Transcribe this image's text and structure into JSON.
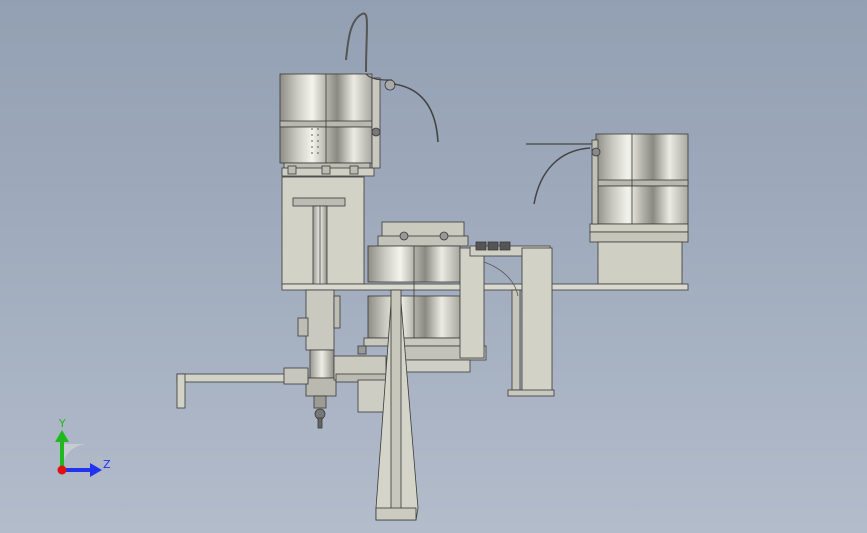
{
  "viewport": {
    "background_top": "#93a0b3",
    "background_bottom": "#b3bccb"
  },
  "triad": {
    "y_label": "Y",
    "z_label": "Z",
    "y_color": "#1fb81f",
    "z_color": "#2233ee",
    "x_color": "#e01010"
  },
  "model": {
    "part_color": "#d2d2c6",
    "drum_light": "#f0f0ea",
    "drum_dark": "#8a8a82",
    "edge_color": "#3a3a3a"
  }
}
